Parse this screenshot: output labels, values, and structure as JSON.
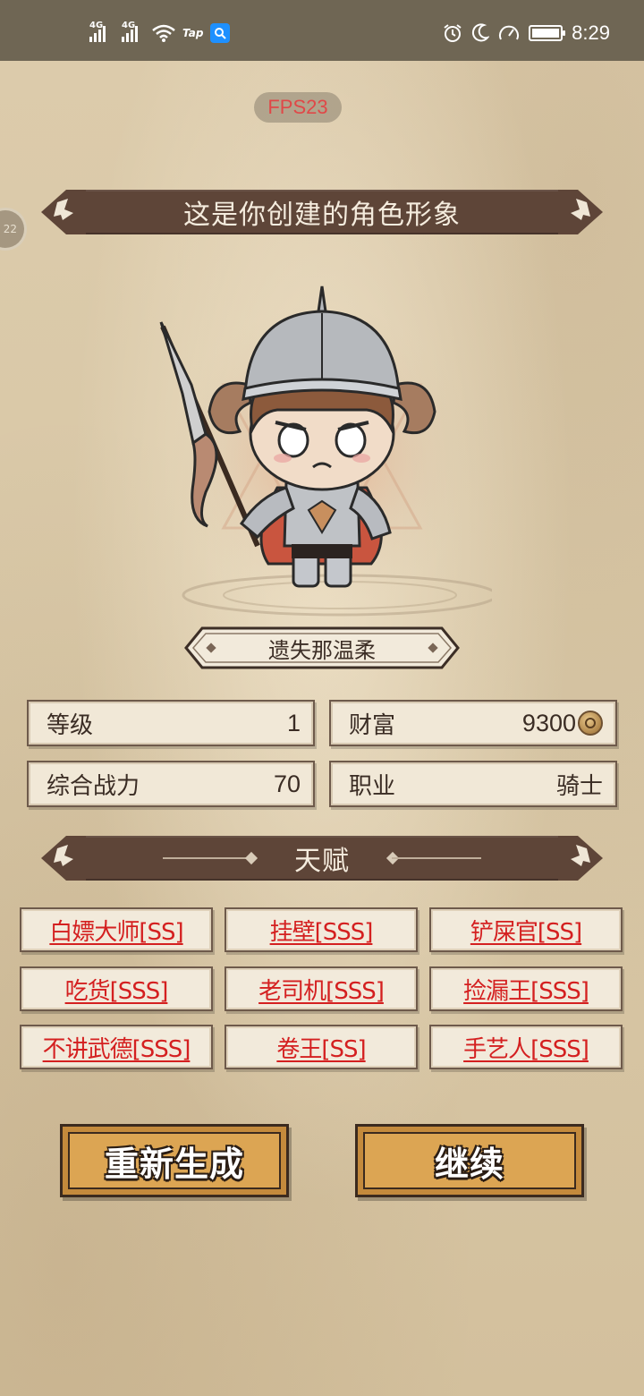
{
  "status_bar": {
    "network_1": "4G",
    "network_2": "4G",
    "tap_label": "Tap",
    "time": "8:29",
    "icons": [
      "signal-icon",
      "signal-icon",
      "wifi-icon",
      "taptap-icon",
      "search-app-icon",
      "alarm-icon",
      "moon-icon",
      "speed-icon",
      "battery-icon"
    ]
  },
  "fps_badge": "FPS23",
  "float_button": "22",
  "header": {
    "title": "这是你创建的角色形象"
  },
  "character": {
    "name": "遗失那温柔"
  },
  "stats": {
    "level_label": "等级",
    "level_value": "1",
    "wealth_label": "财富",
    "wealth_value": "9300",
    "power_label": "综合战力",
    "power_value": "70",
    "class_label": "职业",
    "class_value": "骑士"
  },
  "talents_header": {
    "title": "天赋"
  },
  "talents": [
    "白嫖大师[SS]",
    "挂壁[SSS]",
    "铲屎官[SS]",
    "吃货[SSS]",
    "老司机[SSS]",
    "捡漏王[SSS]",
    "不讲武德[SSS]",
    "卷王[SS]",
    "手艺人[SSS]"
  ],
  "actions": {
    "regenerate": "重新生成",
    "continue": "继续"
  },
  "colors": {
    "banner": "#5e4538",
    "talent_text": "#d42020",
    "button": "#dca553",
    "fps_text": "#e04848"
  }
}
